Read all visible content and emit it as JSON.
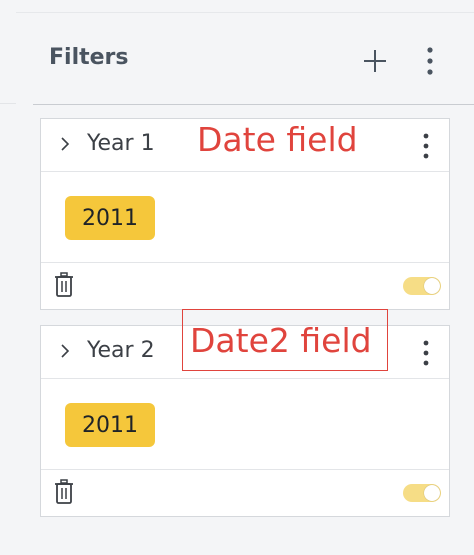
{
  "panel": {
    "title": "Filters",
    "add_icon": "plus-icon",
    "menu_icon": "more-vertical-icon"
  },
  "cards": [
    {
      "title": "Year 1",
      "chip": "2011",
      "toggle_on": true
    },
    {
      "title": "Year 2",
      "chip": "2011",
      "toggle_on": true
    }
  ],
  "annotations": {
    "card1_label": "Date field",
    "card2_label": "Date2 field"
  },
  "colors": {
    "chip": "#f5c73b",
    "toggle": "#f6dd86",
    "annotation": "#e0443d"
  }
}
